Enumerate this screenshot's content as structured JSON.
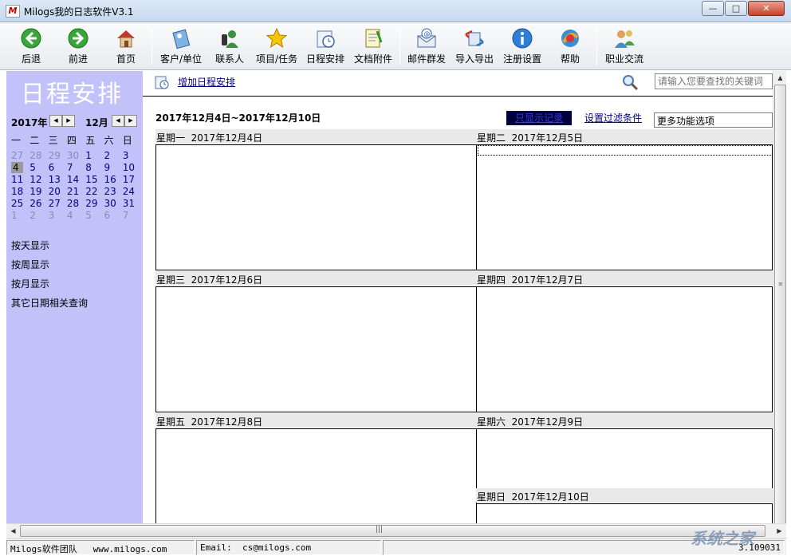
{
  "window": {
    "title": "Milogs我的日志软件V3.1",
    "app_icon_letter": "M",
    "controls": {
      "minimize": "—",
      "maximize": "□",
      "close": "✕"
    }
  },
  "toolbar": {
    "items": [
      {
        "label": "后退",
        "icon": "back-arrow-icon"
      },
      {
        "label": "前进",
        "icon": "forward-arrow-icon"
      },
      {
        "label": "首页",
        "icon": "home-icon"
      },
      {
        "label": "客户/单位",
        "icon": "customer-icon"
      },
      {
        "label": "联系人",
        "icon": "contacts-icon"
      },
      {
        "label": "项目/任务",
        "icon": "star-icon"
      },
      {
        "label": "日程安排",
        "icon": "schedule-icon"
      },
      {
        "label": "文档附件",
        "icon": "document-icon"
      },
      {
        "label": "邮件群发",
        "icon": "mail-icon"
      },
      {
        "label": "导入导出",
        "icon": "import-export-icon"
      },
      {
        "label": "注册设置",
        "icon": "info-icon"
      },
      {
        "label": "帮助",
        "icon": "help-icon"
      },
      {
        "label": "职业交流",
        "icon": "people-icon"
      }
    ]
  },
  "sidebar": {
    "title": "日程安排",
    "calendar": {
      "year": "2017年",
      "month": "12月",
      "weekdays": [
        "一",
        "二",
        "三",
        "四",
        "五",
        "六",
        "日"
      ],
      "weeks": [
        [
          {
            "d": "27",
            "dim": true
          },
          {
            "d": "28",
            "dim": true
          },
          {
            "d": "29",
            "dim": true
          },
          {
            "d": "30",
            "dim": true
          },
          {
            "d": "1"
          },
          {
            "d": "2"
          },
          {
            "d": "3"
          }
        ],
        [
          {
            "d": "4",
            "today": true
          },
          {
            "d": "5"
          },
          {
            "d": "6"
          },
          {
            "d": "7"
          },
          {
            "d": "8"
          },
          {
            "d": "9"
          },
          {
            "d": "10"
          }
        ],
        [
          {
            "d": "11"
          },
          {
            "d": "12"
          },
          {
            "d": "13"
          },
          {
            "d": "14"
          },
          {
            "d": "15"
          },
          {
            "d": "16"
          },
          {
            "d": "17"
          }
        ],
        [
          {
            "d": "18"
          },
          {
            "d": "19"
          },
          {
            "d": "20"
          },
          {
            "d": "21"
          },
          {
            "d": "22"
          },
          {
            "d": "23"
          },
          {
            "d": "24"
          }
        ],
        [
          {
            "d": "25"
          },
          {
            "d": "26"
          },
          {
            "d": "27"
          },
          {
            "d": "28"
          },
          {
            "d": "29"
          },
          {
            "d": "30"
          },
          {
            "d": "31"
          }
        ],
        [
          {
            "d": "1",
            "dim": true
          },
          {
            "d": "2",
            "dim": true
          },
          {
            "d": "3",
            "dim": true
          },
          {
            "d": "4",
            "dim": true
          },
          {
            "d": "5",
            "dim": true
          },
          {
            "d": "6",
            "dim": true
          },
          {
            "d": "7",
            "dim": true
          }
        ]
      ]
    },
    "links": [
      "按天显示",
      "按周显示",
      "按月显示",
      "其它日期相关查询"
    ]
  },
  "main": {
    "add_schedule": "增加日程安排",
    "search_placeholder": "请输入您要查找的关键词",
    "week_range": "2017年12月4日~2017年12月10日",
    "dark_button": "只显示记录",
    "filter_link": "设置过滤条件",
    "more_options": "更多功能选项",
    "days": [
      {
        "weekday": "星期一",
        "date": "2017年12月4日"
      },
      {
        "weekday": "星期二",
        "date": "2017年12月5日"
      },
      {
        "weekday": "星期三",
        "date": "2017年12月6日"
      },
      {
        "weekday": "星期四",
        "date": "2017年12月7日"
      },
      {
        "weekday": "星期五",
        "date": "2017年12月8日"
      },
      {
        "weekday": "星期六",
        "date": "2017年12月9日"
      },
      {
        "weekday": "星期日",
        "date": "2017年12月10日"
      }
    ]
  },
  "statusbar": {
    "team": "Milogs软件团队",
    "website": "www.milogs.com",
    "email_label": "Email:",
    "email": "cs@milogs.com",
    "version": "3.109031"
  },
  "watermark": "系统之家"
}
